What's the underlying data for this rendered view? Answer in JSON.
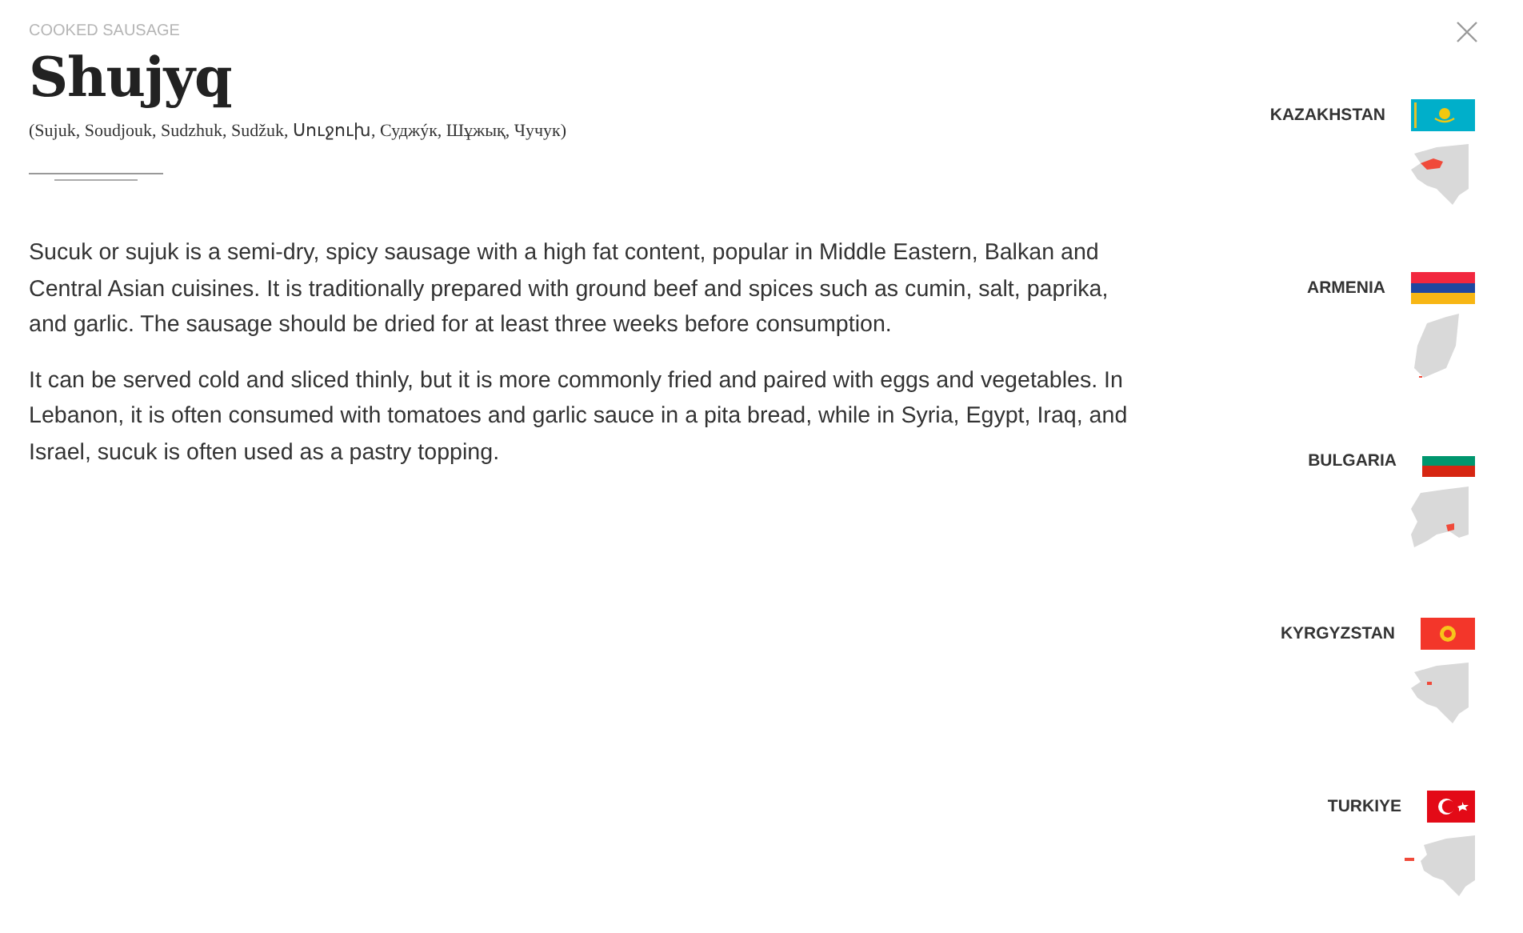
{
  "category": "COOKED SAUSAGE",
  "title": "Shujyq",
  "aliases": "(Sujuk, Soudjouk, Sudzhuk, Sudžuk, Սուջուխ, Суджýк, Шұжық, Чучук)",
  "paragraphs": [
    "Sucuk or sujuk is a semi-dry, spicy sausage with a high fat content, popular in Middle Eastern, Balkan and Central Asian cuisines. It is traditionally prepared with ground beef and spices such as cumin, salt, paprika, and garlic. The sausage should be dried for at least three weeks before consumption.",
    "It can be served cold and sliced thinly, but it is more commonly fried and paired with eggs and vegetables. In Lebanon, it is often consumed with tomatoes and garlic sauce in a pita bread, while in Syria, Egypt, Iraq, and Israel, sucuk is often used as a pastry topping."
  ],
  "countries": [
    {
      "name": "KAZAKHSTAN",
      "kind": "kazakhstan"
    },
    {
      "name": "ARMENIA",
      "kind": "armenia"
    },
    {
      "name": "BULGARIA",
      "kind": "bulgaria"
    },
    {
      "name": "KYRGYZSTAN",
      "kind": "kyrgyzstan"
    },
    {
      "name": "TURKIYE",
      "kind": "turkiye"
    }
  ]
}
